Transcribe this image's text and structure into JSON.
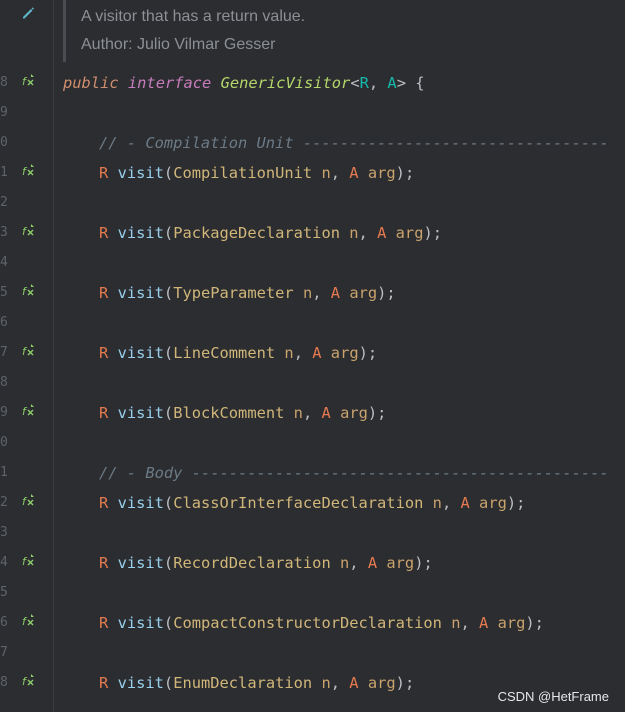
{
  "doc_comment": {
    "line1": "A visitor that has a return value.",
    "line2": "Author: Julio Vilmar Gesser"
  },
  "header": {
    "line_number": "8",
    "kw_public": "public",
    "kw_interface": "interface",
    "name": "GenericVisitor",
    "lt": "<",
    "tp1": "R",
    "comma": ", ",
    "tp2": "A",
    "gt": ">",
    "brace": " {"
  },
  "lines": [
    {
      "n": "9",
      "kind": "blank"
    },
    {
      "n": "0",
      "kind": "comment",
      "text": "// - Compilation Unit ---------------------------------"
    },
    {
      "n": "1",
      "kind": "method",
      "type": "CompilationUnit"
    },
    {
      "n": "2",
      "kind": "blank"
    },
    {
      "n": "3",
      "kind": "method",
      "type": "PackageDeclaration"
    },
    {
      "n": "4",
      "kind": "blank"
    },
    {
      "n": "5",
      "kind": "method",
      "type": "TypeParameter"
    },
    {
      "n": "6",
      "kind": "blank"
    },
    {
      "n": "7",
      "kind": "method",
      "type": "LineComment"
    },
    {
      "n": "8",
      "kind": "blank"
    },
    {
      "n": "9",
      "kind": "method",
      "type": "BlockComment"
    },
    {
      "n": "0",
      "kind": "blank"
    },
    {
      "n": "1",
      "kind": "comment",
      "text": "// - Body ---------------------------------------------"
    },
    {
      "n": "2",
      "kind": "method",
      "type": "ClassOrInterfaceDeclaration"
    },
    {
      "n": "3",
      "kind": "blank"
    },
    {
      "n": "4",
      "kind": "method",
      "type": "RecordDeclaration"
    },
    {
      "n": "5",
      "kind": "blank"
    },
    {
      "n": "6",
      "kind": "method",
      "type": "CompactConstructorDeclaration"
    },
    {
      "n": "7",
      "kind": "blank"
    },
    {
      "n": "8",
      "kind": "method",
      "type": "EnumDeclaration"
    }
  ],
  "method_tokens": {
    "ret": "R",
    "name": "visit",
    "open": "(",
    "param": "n",
    "sep": ", ",
    "argtype": "A",
    "arg": "arg",
    "close": ");"
  },
  "watermark": "CSDN @HetFrame",
  "icons": {
    "doc_edit": "pencil-icon",
    "implemented": "implemented-method-icon"
  },
  "colors": {
    "background": "#2b2d30",
    "keyword": "#cf8e6d",
    "interface_name": "#b5d66b",
    "method_name": "#56a8f5",
    "comment": "#6c7a86"
  }
}
